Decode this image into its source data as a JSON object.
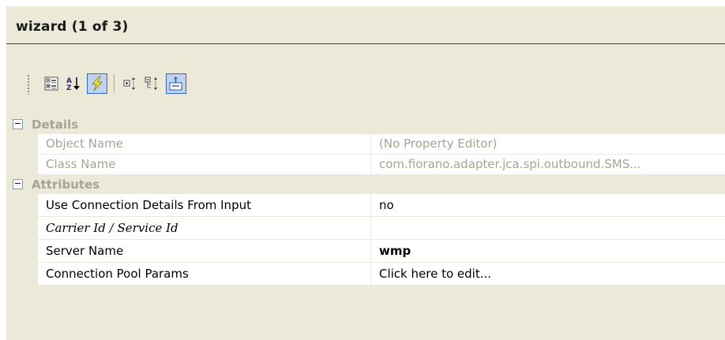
{
  "panel": {
    "title": "wizard (1 of 3)"
  },
  "toolbar": {
    "buttons": [
      {
        "icon": "categorized-view-icon",
        "active": false
      },
      {
        "icon": "alphabetical-sort-icon",
        "active": false
      },
      {
        "icon": "properties-lightning-icon",
        "active": true
      },
      {
        "icon": "expand-all-icon",
        "active": false
      },
      {
        "icon": "collapse-all-icon",
        "active": false
      },
      {
        "icon": "property-pages-icon",
        "active": true
      }
    ]
  },
  "categories": [
    {
      "toggle": "−",
      "label": "Details",
      "properties": [
        {
          "name": "Object Name",
          "value": "(No Property Editor)",
          "disabled": true
        },
        {
          "name": "Class Name",
          "value": "com.fiorano.adapter.jca.spi.outbound.SMS...",
          "disabled": true
        }
      ]
    },
    {
      "toggle": "−",
      "label": "Attributes",
      "properties": [
        {
          "name": "Use Connection Details From Input",
          "value": "no"
        },
        {
          "name": "Carrier Id / Service Id",
          "value": ""
        },
        {
          "name": "Server Name",
          "value": "wmp"
        },
        {
          "name": "Connection Pool Params",
          "value": "Click here to edit..."
        }
      ]
    }
  ],
  "colors": {
    "panel_bg": "#ece9d8",
    "disabled_text": "#a7a395",
    "active_button_bg": "#c1d2ee",
    "active_button_border": "#316ac5"
  }
}
